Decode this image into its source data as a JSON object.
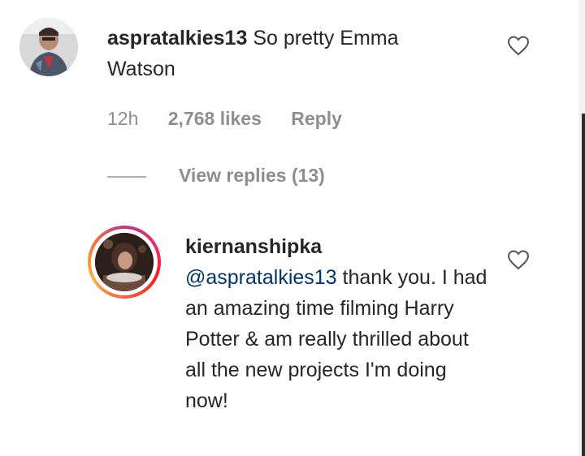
{
  "comment": {
    "username": "aspratalkies13",
    "text": "So pretty Emma Watson",
    "time": "12h",
    "likes": "2,768 likes",
    "reply_label": "Reply",
    "view_replies": "View replies (13)"
  },
  "reply": {
    "username": "kiernanshipka",
    "mention": "@aspratalkies13",
    "text": "thank you. I had an amazing time filming Harry Potter & am really thrilled about all the new projects I'm doing now!"
  },
  "colors": {
    "meta_gray": "#8e8e8e",
    "mention_blue": "#003569",
    "text": "#262626"
  },
  "icons": {
    "like": "heart-outline-icon"
  }
}
